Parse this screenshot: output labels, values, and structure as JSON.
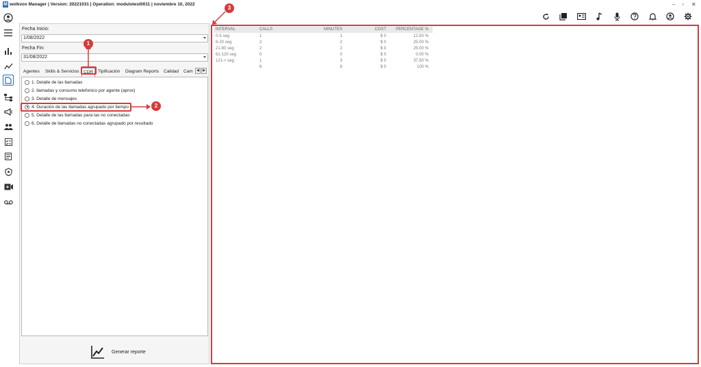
{
  "window": {
    "title": "wolkvox Manager  | Version: 20221031  |  Operation: modulotest0011  |  noviembre 10, 2022",
    "logo_letter": "M",
    "min": "–",
    "restore": "▫",
    "close": "✕"
  },
  "filters": {
    "fecha_inicio_label": "Fecha Inicio:",
    "fecha_inicio_value": "1/08/2022",
    "fecha_fin_label": "Fecha Fin:",
    "fecha_fin_value": "31/08/2022"
  },
  "tabs": [
    {
      "label": "Agentes"
    },
    {
      "label": "Skills & Servicios"
    },
    {
      "label": "CDR"
    },
    {
      "label": "Tipificación"
    },
    {
      "label": "Diagram Reports"
    },
    {
      "label": "Calidad"
    },
    {
      "label": "Cam"
    }
  ],
  "tab_scroll": {
    "left": "◀",
    "right": "▶"
  },
  "options": [
    {
      "label": "1. Detalle de las llamadas"
    },
    {
      "label": "2. llamadas y consumo telefonico por agente (aprox)"
    },
    {
      "label": "3. Detalle de mensajes"
    },
    {
      "label": "4. Duración de las llamadas agrupado por tiempo"
    },
    {
      "label": "5. Detalle de las llamadas para las no conectadas"
    },
    {
      "label": "6. Detalle de llamadas no conectadas agrupado por resultado"
    }
  ],
  "generate_label": "Generar reporte",
  "annotations": {
    "b1": "1",
    "b2": "2",
    "b3": "3"
  },
  "table": {
    "headers": [
      "INTERVAL",
      "CALLS",
      "MINUTES",
      "COST",
      "PERCENTAGE %"
    ],
    "rows": [
      [
        "0-5 seg",
        "1",
        "1",
        "$ 0",
        "12.50 %"
      ],
      [
        "6-20 seg",
        "2",
        "2",
        "$ 0",
        "25.00 %"
      ],
      [
        "21-60 seg",
        "2",
        "2",
        "$ 0",
        "25.00 %"
      ],
      [
        "61-120 seg",
        "0",
        "0",
        "$ 0",
        "0.00 %"
      ],
      [
        "121-> seg",
        "1",
        "3",
        "$ 0",
        "37.50 %"
      ],
      [
        "",
        "6",
        "8",
        "$ 0",
        "100 %"
      ]
    ]
  },
  "colors": {
    "accent": "#d63a3a",
    "logo": "#2b6cb0"
  }
}
